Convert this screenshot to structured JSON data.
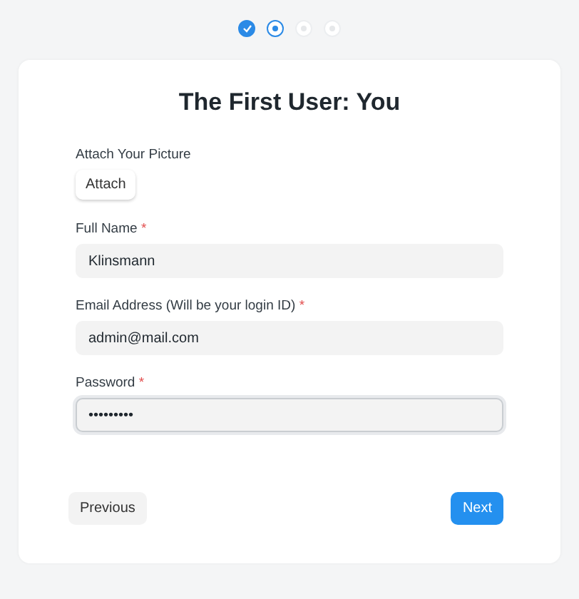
{
  "steps": [
    {
      "completed": true,
      "selected": false
    },
    {
      "completed": false,
      "selected": true
    },
    {
      "completed": false,
      "selected": false
    },
    {
      "completed": false,
      "selected": false
    }
  ],
  "title": "The First User: You",
  "attach": {
    "label": "Attach Your Picture",
    "button": "Attach"
  },
  "fields": [
    {
      "label": "Full Name",
      "required_mark": "*",
      "value": "Klinsmann",
      "focused": false
    },
    {
      "label": "Email Address (Will be your login ID)",
      "required_mark": "*",
      "value": "admin@mail.com",
      "focused": false
    },
    {
      "label": "Password",
      "required_mark": "*",
      "value": "•••••••••",
      "focused": true
    }
  ],
  "buttons": {
    "previous": "Previous",
    "next": "Next"
  }
}
